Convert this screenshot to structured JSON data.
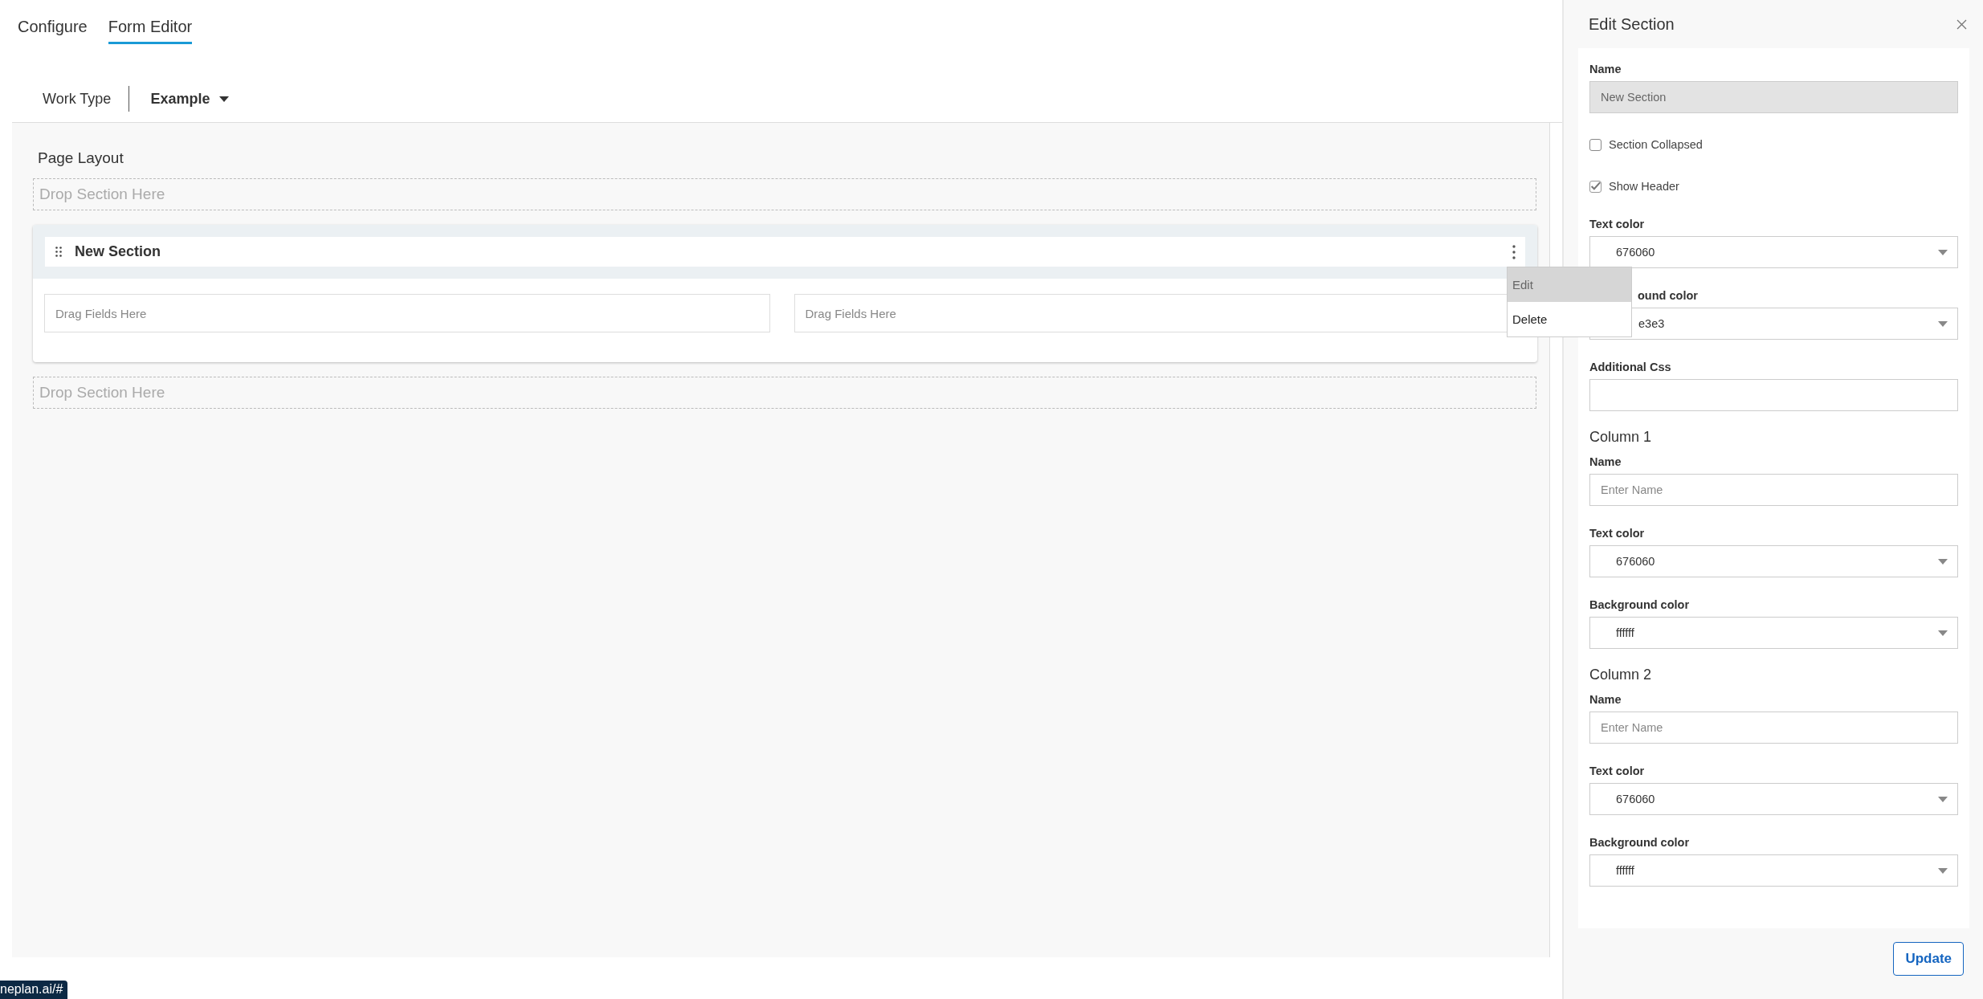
{
  "tabs": [
    {
      "label": "Configure",
      "selected": false
    },
    {
      "label": "Form Editor",
      "selected": true
    }
  ],
  "work_type": {
    "label": "Work Type",
    "value": "Example"
  },
  "page_layout": {
    "title": "Page Layout",
    "items": [
      {
        "kind": "drop",
        "text": "Drop Section Here"
      },
      {
        "kind": "section",
        "title": "New Section",
        "columns": [
          {
            "placeholder": "Drag Fields Here"
          },
          {
            "placeholder": "Drag Fields Here"
          }
        ],
        "menu": [
          {
            "label": "Edit",
            "selected": true
          },
          {
            "label": "Delete",
            "selected": false
          }
        ]
      },
      {
        "kind": "drop",
        "text": "Drop Section Here"
      }
    ]
  },
  "panel": {
    "title": "Edit Section",
    "fields": [
      {
        "kind": "text",
        "label": "Name",
        "value": "New Section",
        "disabled": true
      },
      {
        "kind": "checkbox",
        "label": "Section Collapsed",
        "checked": false
      },
      {
        "kind": "checkbox",
        "label": "Show Header",
        "checked": true
      },
      {
        "kind": "select",
        "label": "Text color",
        "value": "676060"
      },
      {
        "kind": "select",
        "label": "ound color",
        "value": "e3e3",
        "covered": true
      },
      {
        "kind": "text",
        "label": "Additional Css",
        "disabled": false
      },
      {
        "kind": "heading",
        "label": "Column 1"
      },
      {
        "kind": "text",
        "label": "Name",
        "placeholder": "Enter Name",
        "disabled": false
      },
      {
        "kind": "select",
        "label": "Text color",
        "value": "676060"
      },
      {
        "kind": "select",
        "label": "Background color",
        "value": "ffffff"
      },
      {
        "kind": "heading",
        "label": "Column 2"
      },
      {
        "kind": "text",
        "label": "Name",
        "placeholder": "Enter Name",
        "disabled": false
      },
      {
        "kind": "select",
        "label": "Text color",
        "value": "676060"
      },
      {
        "kind": "select",
        "label": "Background color",
        "value": "ffffff"
      }
    ],
    "button": "Update"
  },
  "status_url": "neplan.ai/#"
}
